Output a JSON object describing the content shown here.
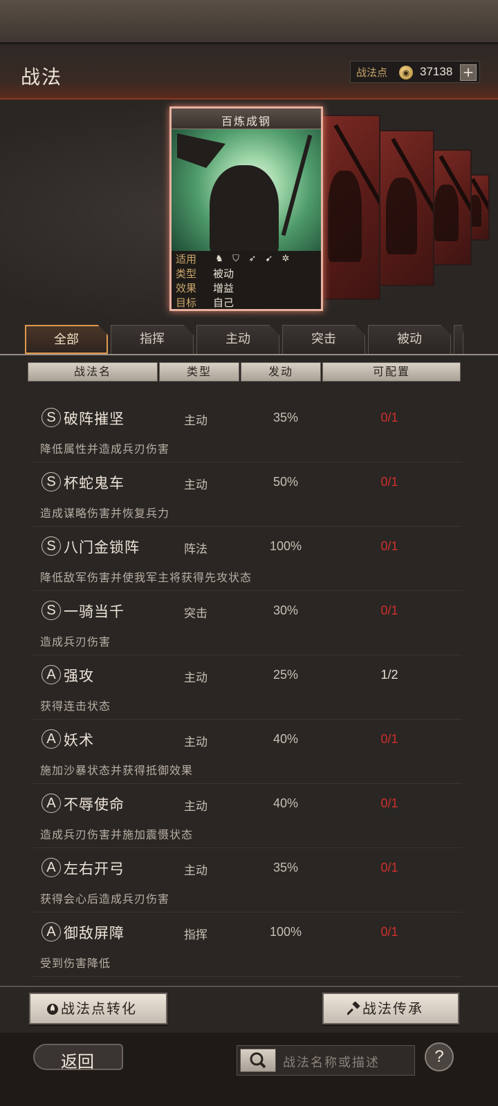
{
  "header": {
    "title": "战法",
    "points_label": "战法点",
    "points_value": "37138",
    "add_label": "+"
  },
  "card": {
    "name": "百炼成钢",
    "attributes": [
      {
        "key": "适用",
        "value": ""
      },
      {
        "key": "类型",
        "value": "被动"
      },
      {
        "key": "效果",
        "value": "增益"
      },
      {
        "key": "目标",
        "value": "自己"
      }
    ],
    "unit_icons": [
      "cavalry-icon",
      "shield-icon",
      "bow-icon",
      "spear-icon",
      "wheel-icon"
    ]
  },
  "tabs": [
    {
      "label": "全部",
      "active": true
    },
    {
      "label": "指挥",
      "active": false
    },
    {
      "label": "主动",
      "active": false
    },
    {
      "label": "突击",
      "active": false
    },
    {
      "label": "被动",
      "active": false
    }
  ],
  "columns": [
    "战法名",
    "类型",
    "发动",
    "可配置"
  ],
  "skills": [
    {
      "grade": "S",
      "name": "破阵摧坚",
      "type": "主动",
      "rate": "35%",
      "slots": "0/1",
      "desc": "降低属性并造成兵刃伤害"
    },
    {
      "grade": "S",
      "name": "杯蛇鬼车",
      "type": "主动",
      "rate": "50%",
      "slots": "0/1",
      "desc": "造成谋略伤害并恢复兵力"
    },
    {
      "grade": "S",
      "name": "八门金锁阵",
      "type": "阵法",
      "rate": "100%",
      "slots": "0/1",
      "desc": "降低敌军伤害并使我军主将获得先攻状态"
    },
    {
      "grade": "S",
      "name": "一骑当千",
      "type": "突击",
      "rate": "30%",
      "slots": "0/1",
      "desc": "造成兵刃伤害"
    },
    {
      "grade": "A",
      "name": "强攻",
      "type": "主动",
      "rate": "25%",
      "slots": "1/2",
      "desc": "获得连击状态"
    },
    {
      "grade": "A",
      "name": "妖术",
      "type": "主动",
      "rate": "40%",
      "slots": "0/1",
      "desc": "施加沙暴状态并获得抵御效果"
    },
    {
      "grade": "A",
      "name": "不辱使命",
      "type": "主动",
      "rate": "40%",
      "slots": "0/1",
      "desc": "造成兵刃伤害并施加震慑状态"
    },
    {
      "grade": "A",
      "name": "左右开弓",
      "type": "主动",
      "rate": "35%",
      "slots": "0/1",
      "desc": "获得会心后造成兵刃伤害"
    },
    {
      "grade": "A",
      "name": "御敌屏障",
      "type": "指挥",
      "rate": "100%",
      "slots": "0/1",
      "desc": "受到伤害降低"
    }
  ],
  "actions": {
    "convert_label": "战法点转化",
    "inherit_label": "战法传承"
  },
  "footer": {
    "back_label": "返回",
    "search_placeholder": "战法名称或描述",
    "help_label": "?"
  },
  "colors": {
    "accent_orange": "#e09a50",
    "slot_red": "#d0302a",
    "gold": "#c9a66b"
  }
}
